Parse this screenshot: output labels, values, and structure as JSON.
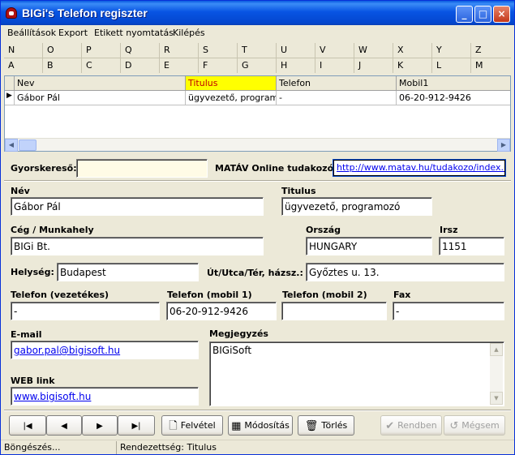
{
  "window": {
    "title": "BIGi's Telefon regiszter"
  },
  "menu": [
    "Beállítások",
    "Export",
    "Etikett nyomtatás",
    "Kilépés"
  ],
  "alphabet": {
    "row1": [
      "N",
      "O",
      "P",
      "Q",
      "R",
      "S",
      "T",
      "U",
      "V",
      "W",
      "X",
      "Y",
      "Z"
    ],
    "row2": [
      "A",
      "B",
      "C",
      "D",
      "E",
      "F",
      "G",
      "H",
      "I",
      "J",
      "K",
      "L",
      "M"
    ]
  },
  "grid": {
    "columns": [
      "Nev",
      "Titulus",
      "Telefon",
      "Mobil1"
    ],
    "sorted_column": "Titulus",
    "rows": [
      {
        "nev": "Gábor Pál",
        "titulus": "ügyvezető, programozó",
        "telefon": "-",
        "mobil1": "06-20-912-9426"
      }
    ]
  },
  "quicksearch": {
    "label": "Gyorskereső:",
    "value": ""
  },
  "online": {
    "label": "MATÁV Online tudakozó:",
    "url": "http://www.matav.hu/tudakozo/index.html"
  },
  "form": {
    "nev": {
      "label": "Név",
      "value": "Gábor Pál"
    },
    "titulus": {
      "label": "Titulus",
      "value": "ügyvezető, programozó"
    },
    "ceg": {
      "label": "Cég / Munkahely",
      "value": "BIGi Bt."
    },
    "orszag": {
      "label": "Ország",
      "value": "HUNGARY"
    },
    "irsz": {
      "label": "Irsz",
      "value": "1151"
    },
    "helyseg": {
      "label": "Helység:",
      "value": "Budapest"
    },
    "utca": {
      "label": "Út/Utca/Tér, házsz.:",
      "value": "Győztes u. 13."
    },
    "telefon": {
      "label": "Telefon (vezetékes)",
      "value": "-"
    },
    "mobil1": {
      "label": "Telefon (mobil 1)",
      "value": "06-20-912-9426"
    },
    "mobil2": {
      "label": "Telefon (mobil 2)",
      "value": ""
    },
    "fax": {
      "label": "Fax",
      "value": "-"
    },
    "email": {
      "label": "E-mail",
      "value": "gabor.pal@bigisoft.hu"
    },
    "megjegyzes": {
      "label": "Megjegyzés",
      "value": "BIGiSoft"
    },
    "web": {
      "label": "WEB link",
      "value": "www.bigisoft.hu"
    }
  },
  "buttons": {
    "felvetel": "Felvétel",
    "modositas": "Módosítás",
    "torles": "Törlés",
    "rendben": "Rendben",
    "megsem": "Mégsem"
  },
  "status": {
    "left": "Böngészés...",
    "right": "Rendezettség: Titulus"
  },
  "colors": {
    "sorted_header": "#ffff00",
    "title_bar": "#0854e3",
    "link": "#0000ee"
  }
}
